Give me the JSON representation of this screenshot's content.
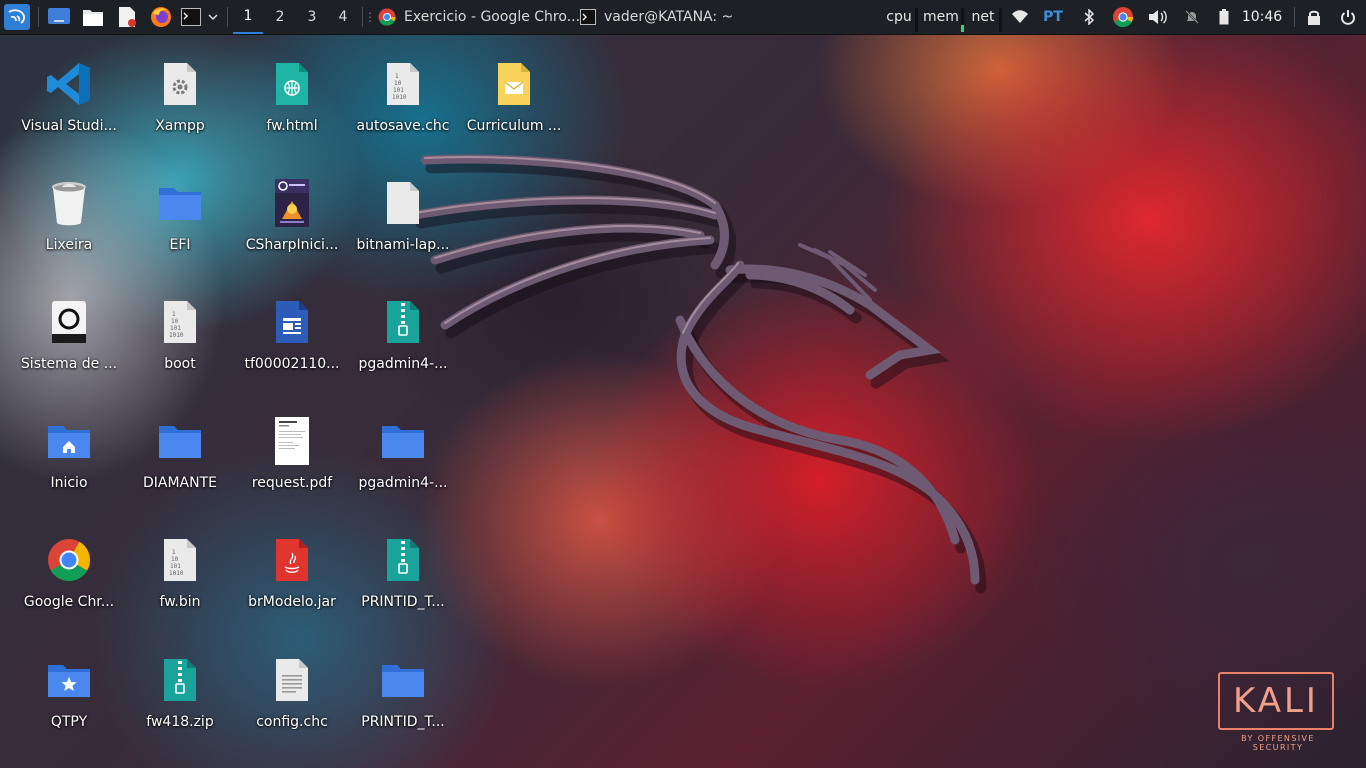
{
  "panel": {
    "workspaces": [
      "1",
      "2",
      "3",
      "4"
    ],
    "active_workspace": "1",
    "tasks": [
      {
        "label": "Exercicio - Google Chro...",
        "icon": "chrome-icon"
      },
      {
        "label": "vader@KATANA: ~",
        "icon": "terminal-icon"
      }
    ],
    "monitors": {
      "cpu": "cpu",
      "mem": "mem",
      "net": "net",
      "mem_level": 0.3
    },
    "keyboard_layout": "PT",
    "clock": "10:46"
  },
  "desktop": {
    "icons": [
      {
        "label": "Visual Studi...",
        "icon": "vscode-icon"
      },
      {
        "label": "Xampp",
        "icon": "settings-file-icon"
      },
      {
        "label": "fw.html",
        "icon": "html-file-icon"
      },
      {
        "label": "autosave.chc",
        "icon": "binary-file-icon"
      },
      {
        "label": "Curriculum ...",
        "icon": "mail-file-icon"
      },
      {
        "label": "Lixeira",
        "icon": "trash-icon"
      },
      {
        "label": "EFI",
        "icon": "folder-icon"
      },
      {
        "label": "CSharpInici...",
        "icon": "book-cover-icon"
      },
      {
        "label": "bitnami-lap...",
        "icon": "blank-file-icon"
      },
      {
        "label": "Sistema de ...",
        "icon": "drive-icon"
      },
      {
        "label": "boot",
        "icon": "binary-file-icon"
      },
      {
        "label": "tf00002110...",
        "icon": "word-file-icon"
      },
      {
        "label": "pgadmin4-...",
        "icon": "zip-file-icon"
      },
      {
        "label": "Inicio",
        "icon": "home-folder-icon"
      },
      {
        "label": "DIAMANTE",
        "icon": "folder-icon"
      },
      {
        "label": "request.pdf",
        "icon": "pdf-file-icon"
      },
      {
        "label": "pgadmin4-...",
        "icon": "folder-icon"
      },
      {
        "label": "Google Chr...",
        "icon": "chrome-icon"
      },
      {
        "label": "fw.bin",
        "icon": "binary-file-icon"
      },
      {
        "label": "brModelo.jar",
        "icon": "java-file-icon"
      },
      {
        "label": "PRINTID_T...",
        "icon": "zip-file-icon"
      },
      {
        "label": "QTPY",
        "icon": "star-folder-icon"
      },
      {
        "label": "fw418.zip",
        "icon": "zip-file-icon"
      },
      {
        "label": "config.chc",
        "icon": "text-file-icon"
      },
      {
        "label": "PRINTID_T...",
        "icon": "folder-icon"
      }
    ]
  },
  "wallpaper": {
    "logo_text": "KALI",
    "logo_subtitle": "BY OFFENSIVE SECURITY"
  },
  "colors": {
    "panel_bg": "#1d2024",
    "accent": "#2f7fd6",
    "folder": "#3b7ae6",
    "zip": "#1aa39a",
    "logo": "#e8836a"
  }
}
